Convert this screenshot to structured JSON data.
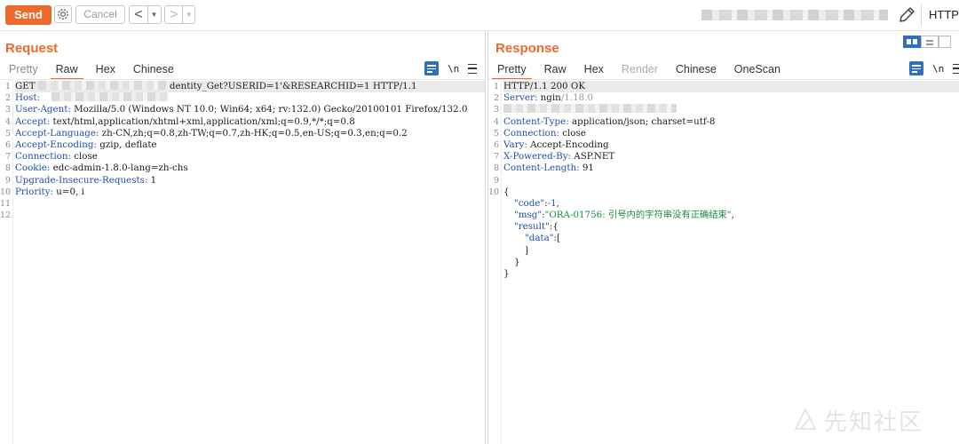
{
  "toolbar": {
    "send_label": "Send",
    "cancel_label": "Cancel",
    "back_arrow": "<",
    "forward_arrow": ">",
    "dropdown_glyph": "▼",
    "http_label": "HTTP/",
    "icons": [
      "settings-gear-icon",
      "edit-pencil-icon"
    ]
  },
  "request": {
    "title": "Request",
    "tabs": [
      "Pretty",
      "Raw",
      "Hex",
      "Chinese"
    ],
    "active_tab": "Raw",
    "newline_label": "\\n",
    "line_numbers": [
      "1",
      "2",
      "3",
      "4",
      "5",
      "6",
      "7",
      "8",
      "9",
      "10",
      "11",
      "12"
    ],
    "lines": {
      "l1_method": "GET ",
      "l1_rest": "dentity_Get?USERID=1'&RESEARCHID=1 HTTP/1.1",
      "l2_key": "Host: ",
      "l3_key": "User-Agent: ",
      "l3_val": "Mozilla/5.0 (Windows NT 10.0; Win64; x64; rv:132.0) Gecko/20100101 Firefox/132.0",
      "l4_key": "Accept: ",
      "l4_val": "text/html,application/xhtml+xml,application/xml;q=0.9,*/*;q=0.8",
      "l5_key": "Accept-Language: ",
      "l5_val": "zh-CN,zh;q=0.8,zh-TW;q=0.7,zh-HK;q=0.5,en-US;q=0.3,en;q=0.2",
      "l6_key": "Accept-Encoding: ",
      "l6_val": "gzip, deflate",
      "l7_key": "Connection: ",
      "l7_val": "close",
      "l8_key": "Cookie: ",
      "l8_val": "edc-admin-1.8.0-lang=zh-chs",
      "l9_key": "Upgrade-Insecure-Requests: ",
      "l9_val": "1",
      "l10_key": "Priority: ",
      "l10_val": "u=0, i"
    }
  },
  "response": {
    "title": "Response",
    "tabs": [
      "Pretty",
      "Raw",
      "Hex",
      "Render",
      "Chinese",
      "OneScan"
    ],
    "active_tab": "Pretty",
    "newline_label": "\\n",
    "line_numbers": [
      "1",
      "2",
      "3",
      "4",
      "5",
      "6",
      "7",
      "8",
      "9",
      "10",
      "",
      "",
      "",
      "",
      "",
      "",
      "",
      ""
    ],
    "lines": {
      "l1": "HTTP/1.1 200 OK",
      "l2_key": "Server: ",
      "l2_val": "ngin",
      "l2_tail": "/1.18.0",
      "l4_key": "Content-Type: ",
      "l4_val": "application/json; charset=utf-8",
      "l5_key": "Connection: ",
      "l5_val": "close",
      "l6_key": "Vary: ",
      "l6_val": "Accept-Encoding",
      "l7_key": "X-Powered-By: ",
      "l7_val": "ASP.NET",
      "l8_key": "Content-Length: ",
      "l8_val": "91",
      "j_open": "{",
      "code_key": "\"code\"",
      "code_val": "-1",
      "msg_key": "\"msg\"",
      "msg_val": "\"ORA-01756: 引号内的字符串没有正确结束\"",
      "result_key": "\"result\"",
      "data_key": "\"data\"",
      "colon": ":",
      "comma": ",",
      "lbrace": "{",
      "lbracket": "[",
      "rbracket": "]",
      "rbrace": "}",
      "j_close": "}"
    }
  },
  "watermark": "先知社区",
  "colors": {
    "accent": "#ee6a2b",
    "key_blue": "#1f4fa8",
    "string_green": "#1b8a3b",
    "tool_blue": "#2f6fbd"
  }
}
